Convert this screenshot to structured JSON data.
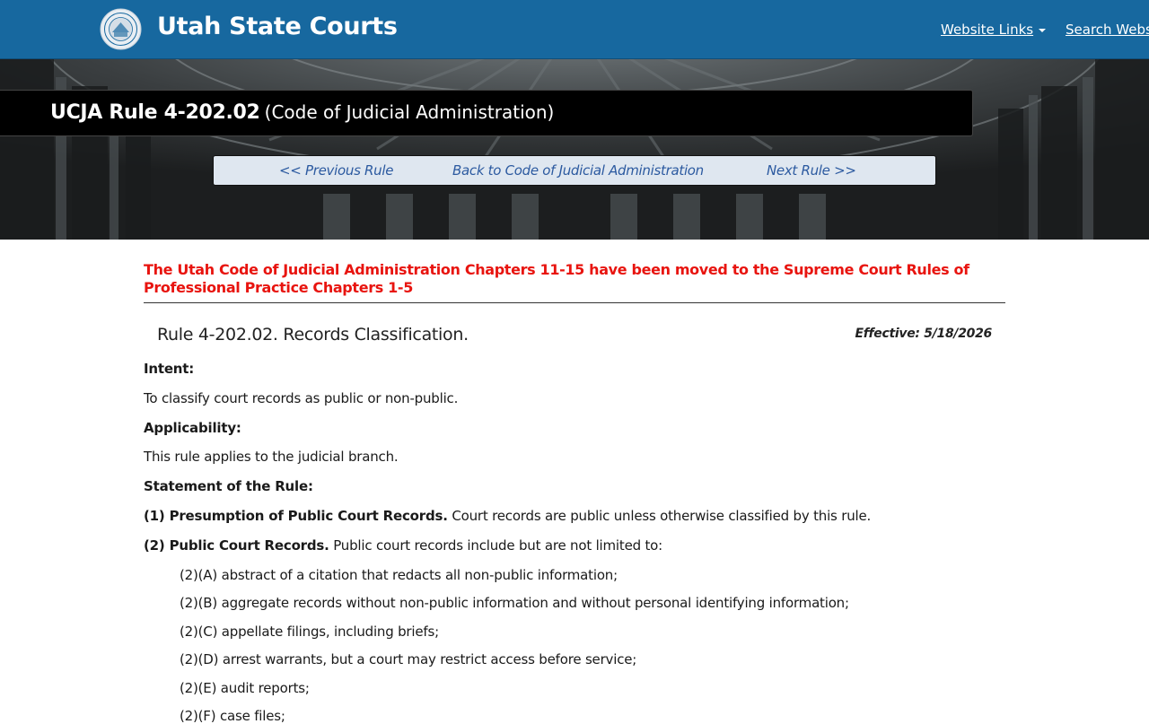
{
  "header": {
    "site_title": "Utah State Courts",
    "nav": {
      "website_links": "Website Links",
      "search": "Search Website"
    },
    "brand_color": "#17689f"
  },
  "banner": {
    "rule_id": "UCJA Rule 4-202.02",
    "rule_source": "(Code of Judicial Administration)"
  },
  "rule_nav": {
    "previous": "<< Previous Rule",
    "back": "Back to Code of Judicial Administration",
    "next": "Next Rule >>"
  },
  "notice": "The Utah Code of Judicial Administration Chapters 11-15 have been moved to the Supreme Court Rules of Professional Practice Chapters 1-5",
  "rule": {
    "heading": "Rule 4-202.02. Records Classification.",
    "effective": "Effective: 5/18/2026",
    "intent_label": "Intent:",
    "intent_text": "To classify court records as public or non-public.",
    "applicability_label": "Applicability:",
    "applicability_text": "This rule applies to the judicial branch.",
    "statement_label": "Statement of the Rule:",
    "s1_label": "(1) Presumption of Public Court Records.",
    "s1_text": " Court records are public unless otherwise classified by this rule.",
    "s2_label": "(2) Public Court Records.",
    "s2_text": " Public court records include but are not limited to:",
    "items": [
      "(2)(A) abstract of a citation that redacts all non-public information;",
      "(2)(B) aggregate records without non-public information and without personal identifying information;",
      "(2)(C) appellate filings, including briefs;",
      "(2)(D) arrest warrants, but a court may restrict access before service;",
      "(2)(E) audit reports;",
      "(2)(F) case files;"
    ]
  }
}
